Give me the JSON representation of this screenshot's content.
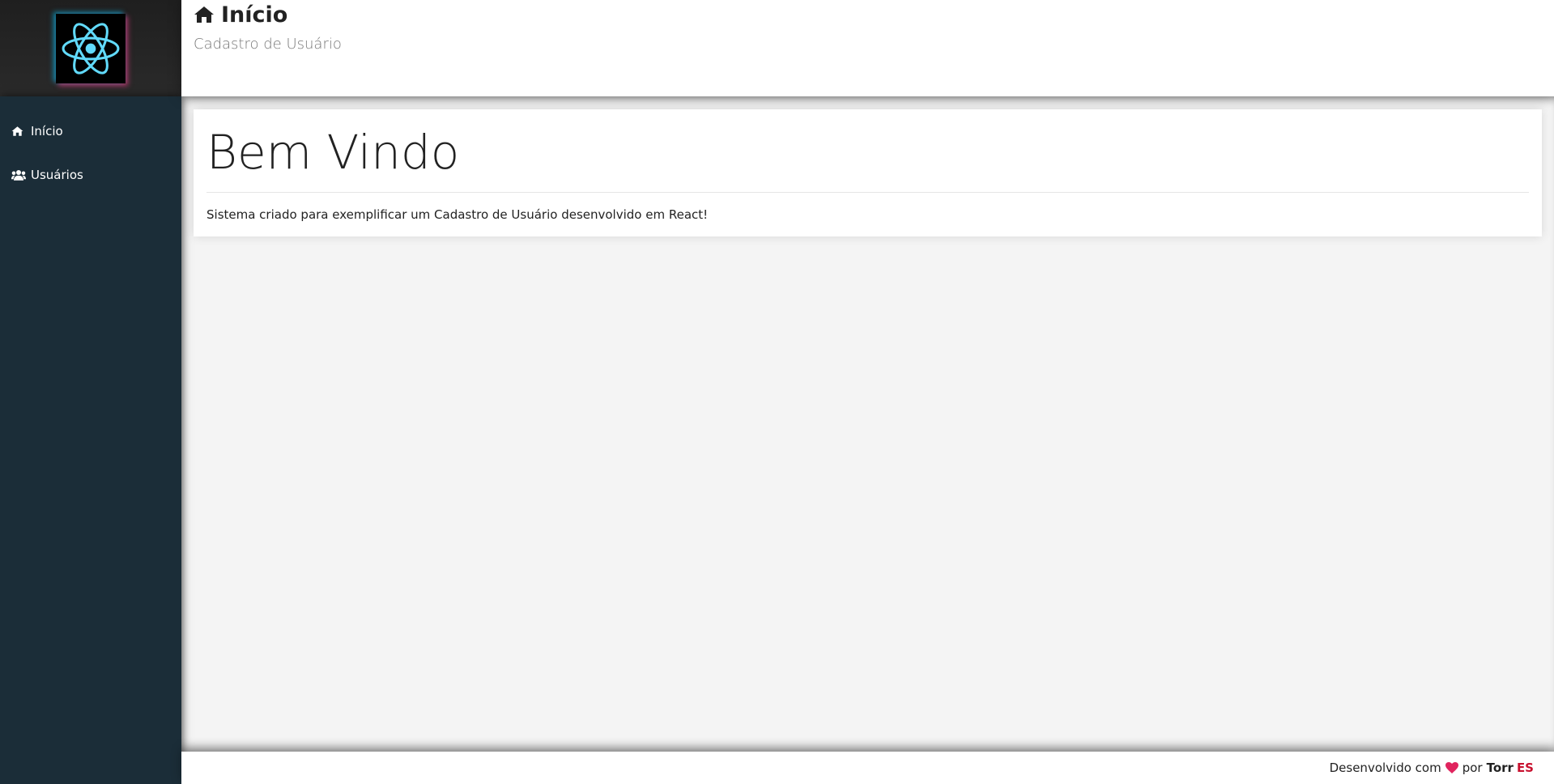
{
  "header": {
    "title": "Início",
    "subtitle": "Cadastro de Usuário",
    "title_icon": "home-icon"
  },
  "logo": {
    "icon": "react-atom-icon",
    "color": "#61dafb"
  },
  "menu": {
    "items": [
      {
        "label": "Início",
        "icon": "home-icon"
      },
      {
        "label": "Usuários",
        "icon": "users-icon"
      }
    ]
  },
  "main": {
    "heading": "Bem Vindo",
    "description": "Sistema criado para exemplificar um Cadastro de Usuário desenvolvido em React!"
  },
  "footer": {
    "text_before": "Desenvolvido com",
    "heart_icon": "heart-icon",
    "text_after": "por",
    "brand_part1": "Torr",
    "brand_part2": "ES",
    "heart_color": "#e0245e",
    "brand_accent_color": "#c8102e"
  },
  "colors": {
    "sidebar_bg": "#1b2d38",
    "content_bg": "#f4f4f4"
  }
}
